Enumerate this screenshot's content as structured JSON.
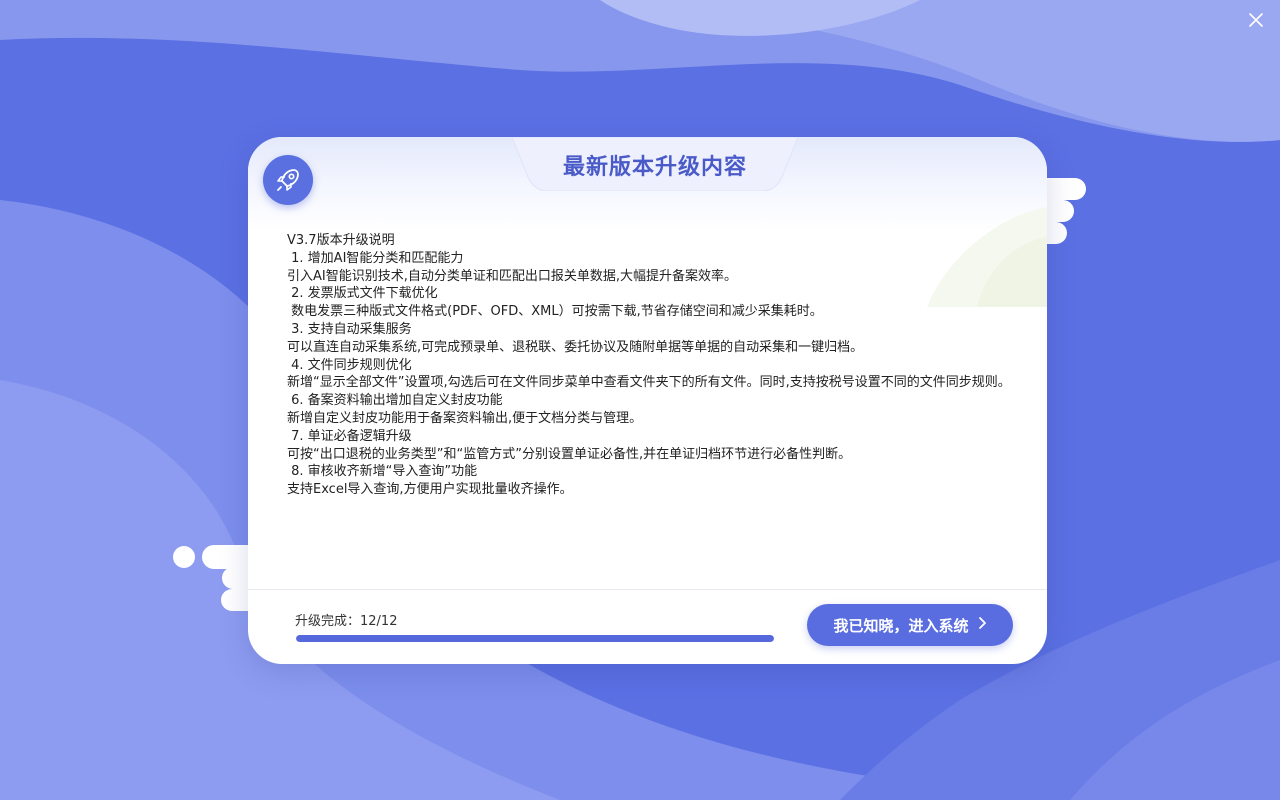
{
  "window": {
    "close_icon": "close-icon"
  },
  "dialog": {
    "title": "最新版本升级内容",
    "badge_icon": "rocket-icon"
  },
  "release_notes": [
    "V3.7版本升级说明",
    " 1. 增加AI智能分类和匹配能力",
    "引入AI智能识别技术,自动分类单证和匹配出口报关单数据,大幅提升备案效率。",
    " 2. 发票版式文件下载优化",
    " 数电发票三种版式文件格式(PDF、OFD、XML）可按需下载,节省存储空间和减少采集耗时。",
    " 3. 支持自动采集服务",
    "可以直连自动采集系统,可完成预录单、退税联、委托协议及随附单据等单据的自动采集和一键归档。",
    " 4. 文件同步规则优化",
    "新增“显示全部文件”设置项,勾选后可在文件同步菜单中查看文件夹下的所有文件。同时,支持按税号设置不同的文件同步规则。",
    " 6. 备案资料输出增加自定义封皮功能",
    "新增自定义封皮功能用于备案资料输出,便于文档分类与管理。",
    " 7. 单证必备逻辑升级",
    "可按“出口退税的业务类型”和“监管方式”分别设置单证必备性,并在单证归档环节进行必备性判断。",
    " 8. 审核收齐新增“导入查询”功能",
    "支持Excel导入查询,方便用户实现批量收齐操作。"
  ],
  "progress": {
    "label": "升级完成：12/12",
    "completed": 12,
    "total": 12,
    "fraction": 1.0
  },
  "actions": {
    "enter_label": "我已知晓，进入系统",
    "enter_icon": "chevron-right-icon"
  },
  "colors": {
    "background": "#5b70e3",
    "accent": "#5a6de0",
    "title": "#4a5bc9"
  }
}
